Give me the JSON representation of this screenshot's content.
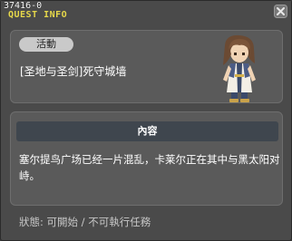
{
  "window": {
    "quest_id": "37416-0",
    "title": "QUEST INFO",
    "close_icon": "close-icon"
  },
  "header": {
    "category": "活動",
    "quest_name": "[圣地与圣剑]死守城墙",
    "portrait_icon": "npc-portrait-icon"
  },
  "content": {
    "header": "內容",
    "text": "塞尔提鸟广场已经一片混乱，卡莱尔正在其中与黑太阳对峙。"
  },
  "status": {
    "text": "狀態: 可開始 / 不可執行任務"
  },
  "colors": {
    "title": "#e6d84a",
    "panel": "#5a5a5a",
    "content_header": "#3f464e",
    "badge": "#c9c9c9"
  }
}
